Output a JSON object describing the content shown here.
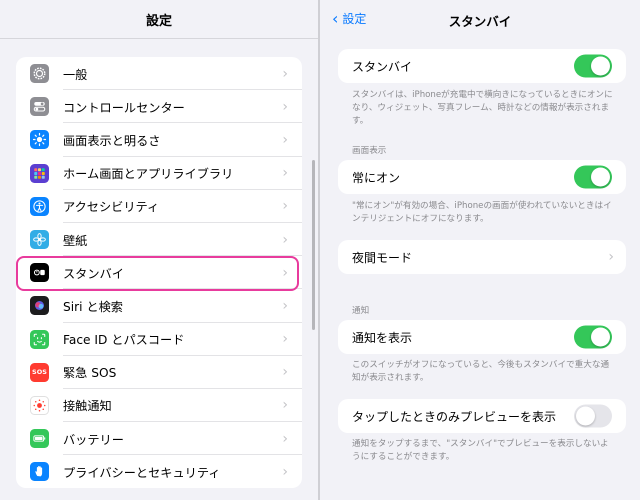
{
  "left": {
    "title": "設定",
    "items": [
      {
        "label": "一般",
        "icon": "gear-icon",
        "color": "#8e8e93"
      },
      {
        "label": "コントロールセンター",
        "icon": "toggles-icon",
        "color": "#8e8e93"
      },
      {
        "label": "画面表示と明るさ",
        "icon": "sun-icon",
        "color": "#0a84ff"
      },
      {
        "label": "ホーム画面とアプリライブラリ",
        "icon": "app-grid-icon",
        "color": "#5b3fd1"
      },
      {
        "label": "アクセシビリティ",
        "icon": "accessibility-icon",
        "color": "#0a84ff"
      },
      {
        "label": "壁紙",
        "icon": "flower-icon",
        "color": "#32ade6"
      },
      {
        "label": "スタンバイ",
        "icon": "standby-icon",
        "color": "#000000"
      },
      {
        "label": "Siri と検索",
        "icon": "siri-icon",
        "color": "#1c1c1e"
      },
      {
        "label": "Face ID とパスコード",
        "icon": "face-id-icon",
        "color": "#34c759"
      },
      {
        "label": "緊急 SOS",
        "icon": "sos-icon",
        "color": "#ff3b30"
      },
      {
        "label": "接触通知",
        "icon": "exposure-icon",
        "color": "#ffffff"
      },
      {
        "label": "バッテリー",
        "icon": "battery-icon",
        "color": "#34c759"
      },
      {
        "label": "プライバシーとセキュリティ",
        "icon": "hand-icon",
        "color": "#0a84ff"
      }
    ],
    "sos_text": "SOS",
    "highlight_color": "#e83b9d"
  },
  "right": {
    "back_label": "設定",
    "title": "スタンバイ",
    "standby": {
      "label": "スタンバイ",
      "toggle": true
    },
    "standby_footnote": "スタンバイは、iPhoneが充電中で横向きになっているときにオンになり、ウィジェット、写真フレーム、時計などの情報が表示されます。",
    "display_section": "画面表示",
    "always_on": {
      "label": "常にオン",
      "toggle": true
    },
    "always_on_footnote": "\"常にオン\"が有効の場合、iPhoneの画面が使われていないときはインテリジェントにオフになります。",
    "night_mode": {
      "label": "夜間モード"
    },
    "notifications_section": "通知",
    "show_notifications": {
      "label": "通知を表示",
      "toggle": true
    },
    "show_notifications_footnote": "このスイッチがオフになっていると、今後もスタンバイで重大な通知が表示されます。",
    "preview_on_tap": {
      "label": "タップしたときのみプレビューを表示",
      "toggle": false
    },
    "preview_footnote": "通知をタップするまで、\"スタンバイ\"でプレビューを表示しないようにすることができます。"
  },
  "colors": {
    "accent": "#0a7aff",
    "toggle_on": "#34c759",
    "toggle_off": "#e5e5ea"
  }
}
